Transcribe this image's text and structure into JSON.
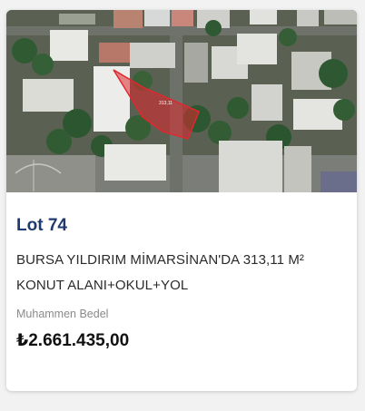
{
  "listing": {
    "image_alt": "Satellite view of the parcel",
    "map_parcel_label": "313,11",
    "title": "Lot 74",
    "description": "BURSA YILDIRIM MİMARSİNAN'DA 313,11 M² KONUT ALANI+OKUL+YOL",
    "seller": "Muhammen Bedel",
    "price": "₺2.661.435,00",
    "parcel_color": "#e0282e"
  }
}
